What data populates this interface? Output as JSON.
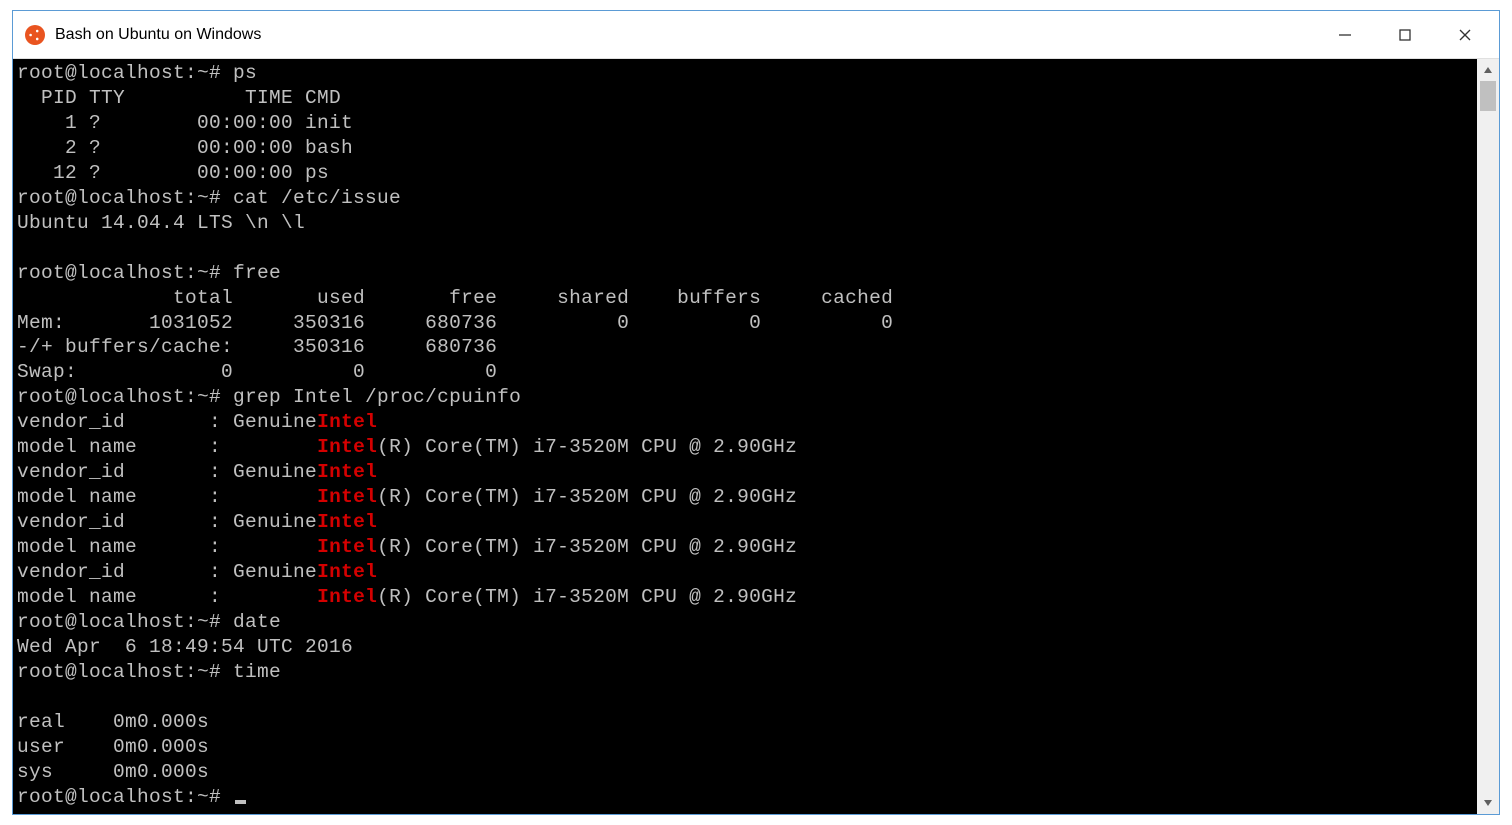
{
  "window": {
    "title": "Bash on Ubuntu on Windows"
  },
  "terminal": {
    "prompt": "root@localhost:~#",
    "commands": {
      "ps": {
        "cmd": "ps",
        "header": "  PID TTY          TIME CMD",
        "rows": [
          "    1 ?        00:00:00 init",
          "    2 ?        00:00:00 bash",
          "   12 ?        00:00:00 ps"
        ]
      },
      "cat_issue": {
        "cmd": "cat /etc/issue",
        "output": "Ubuntu 14.04.4 LTS \\n \\l"
      },
      "free": {
        "cmd": "free",
        "header": "             total       used       free     shared    buffers     cached",
        "rows": [
          "Mem:       1031052     350316     680736          0          0          0",
          "-/+ buffers/cache:     350316     680736",
          "Swap:            0          0          0"
        ]
      },
      "grep": {
        "cmd": "grep Intel /proc/cpuinfo",
        "highlight": "Intel",
        "vendor_line_pre": "vendor_id       : Genuine",
        "model_line_pre": "model name      :        ",
        "model_line_post": "(R) Core(TM) i7-3520M CPU @ 2.90GHz",
        "repeat": 4
      },
      "date": {
        "cmd": "date",
        "output": "Wed Apr  6 18:49:54 UTC 2016"
      },
      "time": {
        "cmd": "time",
        "rows": [
          "real    0m0.000s",
          "user    0m0.000s",
          "sys     0m0.000s"
        ]
      }
    }
  }
}
